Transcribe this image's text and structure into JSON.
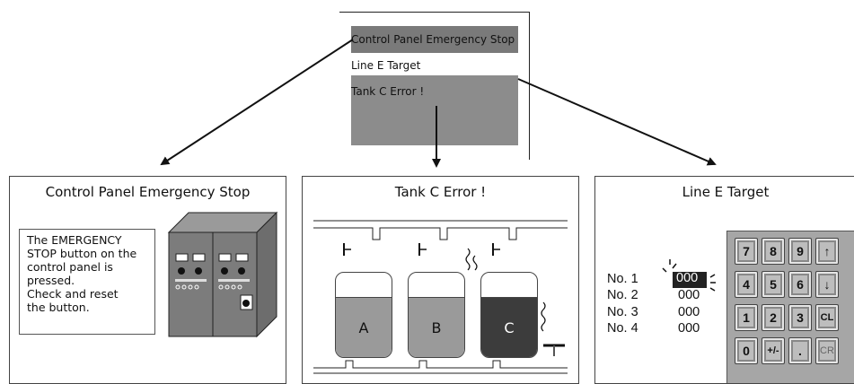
{
  "screen_menu": {
    "items": [
      {
        "label": "Control Panel Emergency Stop"
      },
      {
        "label": "Line E Target"
      },
      {
        "label": "Tank C Error !"
      }
    ]
  },
  "panels": {
    "control_panel": {
      "title": "Control Panel Emergency Stop",
      "message": "The EMERGENCY\nSTOP button on the\ncontrol panel is\npressed.\nCheck and reset\nthe button."
    },
    "tank_error": {
      "title": "Tank C Error !",
      "tanks": [
        "A",
        "B",
        "C"
      ]
    },
    "line_target": {
      "title": "Line E Target",
      "rows": [
        {
          "label": "No. 1",
          "value": "000"
        },
        {
          "label": "No. 2",
          "value": "000"
        },
        {
          "label": "No. 3",
          "value": "000"
        },
        {
          "label": "No. 4",
          "value": "000"
        }
      ],
      "keypad": [
        [
          "7",
          "8",
          "9",
          "↑"
        ],
        [
          "4",
          "5",
          "6",
          "↓"
        ],
        [
          "1",
          "2",
          "3",
          "CL"
        ],
        [
          "0",
          "+/-",
          ".",
          "CR"
        ]
      ]
    }
  },
  "colors": {
    "highlight": "#7a7a7a",
    "menu_box": "#8c8c8c",
    "tank_a": "#9a9a9a",
    "tank_b": "#9a9a9a",
    "tank_c": "#3c3c3c"
  }
}
